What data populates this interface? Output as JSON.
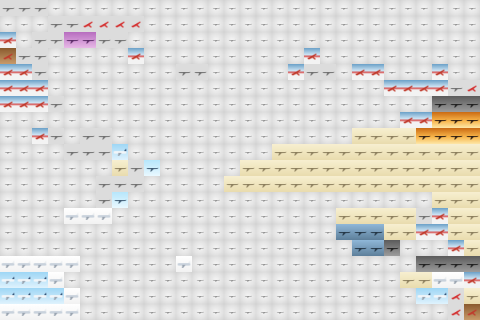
{
  "mosaic": {
    "columns": 30,
    "rows": 20,
    "legend": {
      "g": "grey-placeholder-tile",
      "r": "red-propeller-plane-on-white",
      "j": "silver-jet-on-white",
      "w": "airliner-on-white",
      "s": "airliner-on-blue-sky",
      "d": "plane-on-beige",
      "o": "plane-at-sunset",
      "c": "red-plane-on-brown",
      "v": "airshow-purple",
      "t": "plane-on-teal-sky",
      "b": "jet-on-light-blue",
      "k": "dark-military-aircraft",
      "x": "airshow-red-white"
    },
    "colors": {
      "grey": "#e2e2e2",
      "red_plane": "#c0392b",
      "silver": "#8a8a8a",
      "sky": "#9ed6f5",
      "beige": "#f0e4bc",
      "sunset": "#f29a2e",
      "purple": "#b76cbf"
    },
    "grid": [
      "jjjggggggggggggggggggggggggggg",
      "gggjjxxxxggggggggggggggggggggg",
      "rgjjvvjjgggggggggggggggggggggg",
      "cjjgggggrggggggggggrgggggggggg",
      "rrjggggggggjjgggggrjjgrrgggrgg",
      "rrrgggggggggggggggggggggrrrrjx",
      "rrrjgggggggggggggggggggggggkkk",
      "gggggggggggggggggggggggggrrooo",
      "ggrjgjjgggggggggggggggddddoooo",
      "ggggjjjsgggggggggddddddddddddd",
      "gggggggdjbgggggddddddddddddddd",
      "ggggggjjjgggggdddddddddddddddd",
      "ggggggjbgggggggggggggggggggddd",
      "ggggwwwggggggggggggggdddddjrdd",
      "gggggggggggggggggggggtttddrrdd",
      "ggggggggggggggggggggggttkgggrdk",
      "wwwwwggggggwggggggggggggggkkkk",
      "ssswgggggggggggggggggggggddwwr",
      "sssswgggggggggggggggggggggssxd",
      "wwwwwgggggggggggggggggggggggxc"
    ]
  }
}
